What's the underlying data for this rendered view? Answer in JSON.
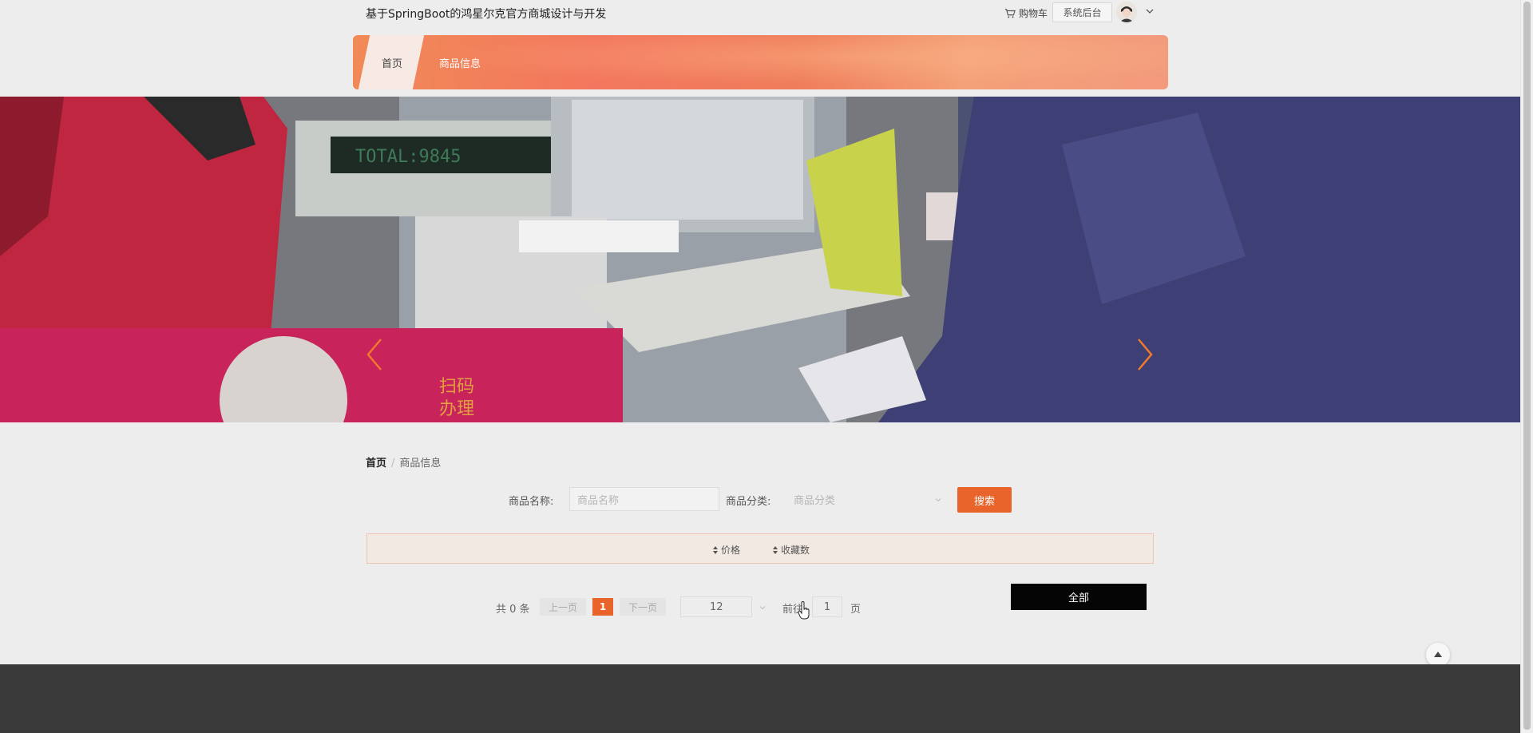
{
  "header": {
    "site_title": "基于SpringBoot的鸿星尔克官方商城设计与开发",
    "cart_label": "购物车",
    "cart_icon": "cart-icon",
    "admin_label": "系统后台",
    "avatar_icon": "user-avatar",
    "dropdown_icon": "chevron-down-icon"
  },
  "nav": {
    "items": [
      {
        "label": "首页",
        "active": true
      },
      {
        "label": "商品信息",
        "active": false
      }
    ]
  },
  "banner": {
    "display_text": "TOTAL:9845",
    "sign_text_1": "扫码",
    "sign_text_2": "办理",
    "prev_icon": "chevron-left-icon",
    "next_icon": "chevron-right-icon"
  },
  "breadcrumb": {
    "home": "首页",
    "separator": "/",
    "current": "商品信息"
  },
  "search": {
    "name_label": "商品名称:",
    "name_placeholder": "商品名称",
    "category_label": "商品分类:",
    "category_placeholder": "商品分类",
    "button_label": "搜索"
  },
  "sort": {
    "items": [
      {
        "label": "价格",
        "icon": "sort-icon"
      },
      {
        "label": "收藏数",
        "icon": "sort-icon"
      }
    ]
  },
  "pagination": {
    "total": "共 0 条",
    "prev": "上一页",
    "current_page": "1",
    "next": "下一页",
    "page_size": "12",
    "goto_label": "前往",
    "goto_value": "1",
    "page_unit": "页"
  },
  "all_button": "全部",
  "colors": {
    "accent": "#e8642a",
    "footer": "#3a3a3a",
    "nav_gradient_start": "#f08a56"
  }
}
